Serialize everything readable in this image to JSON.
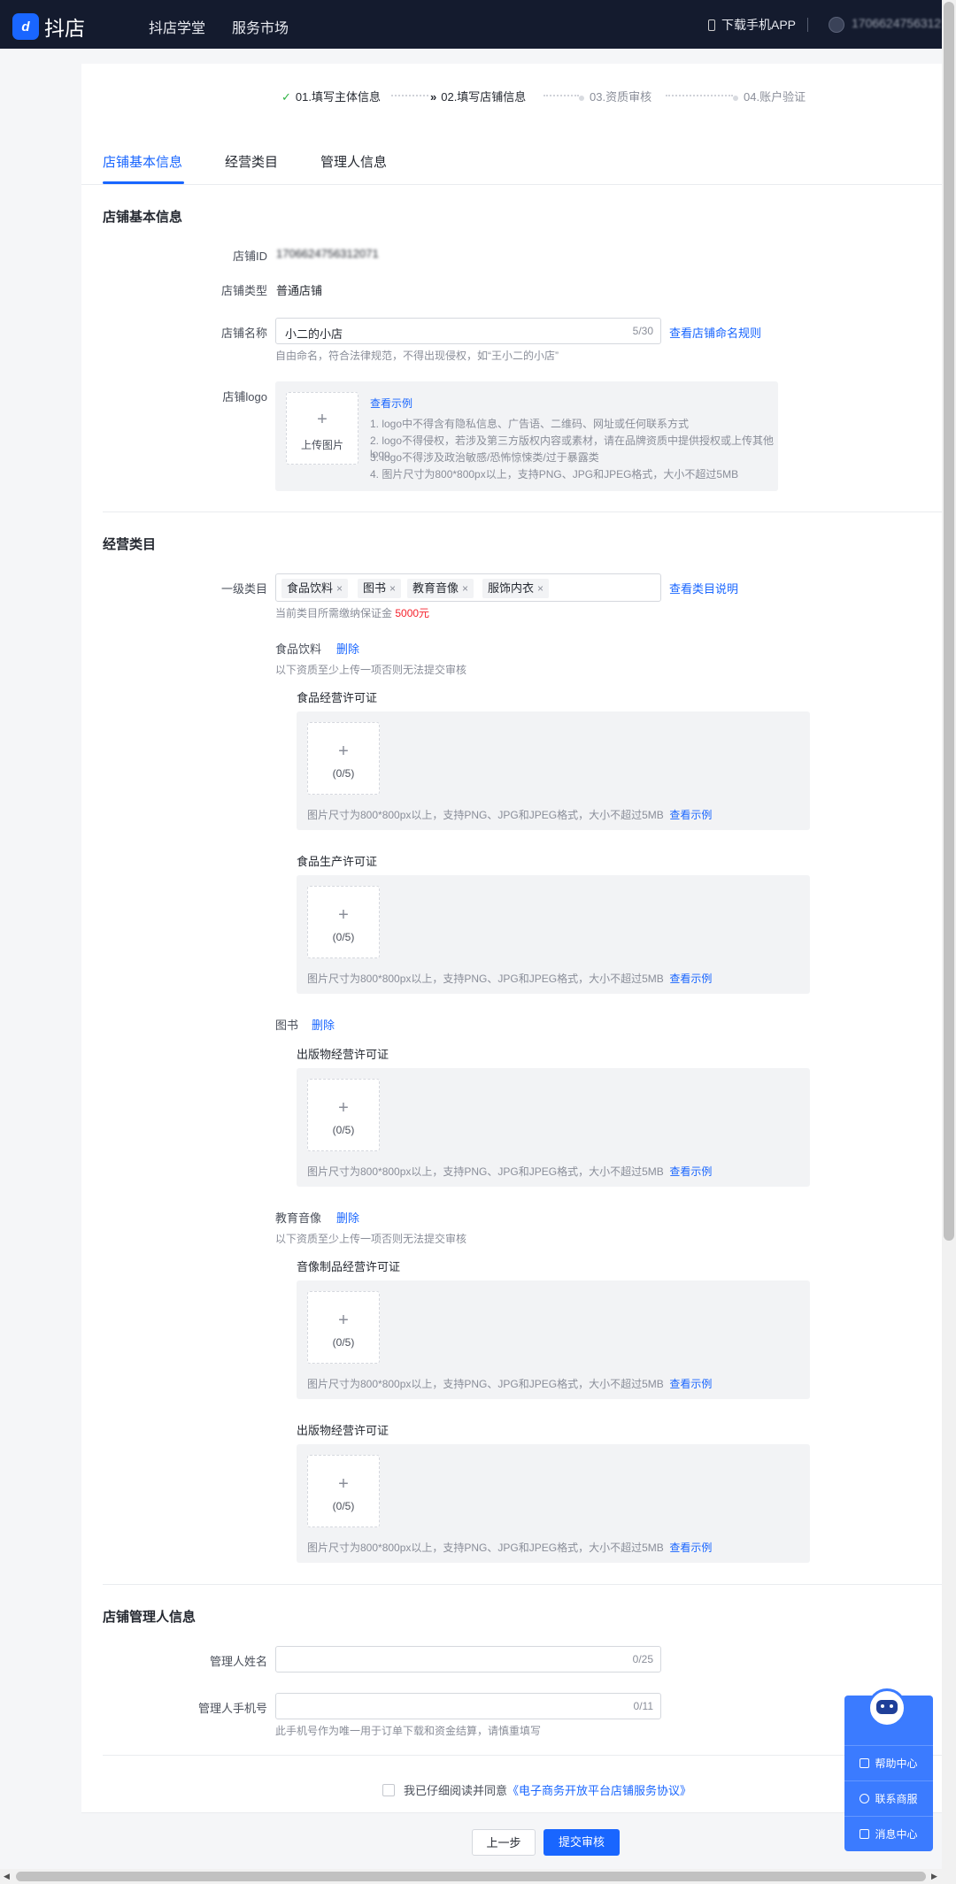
{
  "header": {
    "logo_text": "抖店",
    "nav": [
      "抖店学堂",
      "服务市场"
    ],
    "download_app": "下载手机APP",
    "user_id": "1706624756312"
  },
  "steps": [
    {
      "label": "01.填写主体信息",
      "state": "done"
    },
    {
      "label": "02.填写店铺信息",
      "state": "active"
    },
    {
      "label": "03.资质审核",
      "state": "todo"
    },
    {
      "label": "04.账户验证",
      "state": "todo"
    }
  ],
  "tabs": [
    "店铺基本信息",
    "经营类目",
    "管理人信息"
  ],
  "basic": {
    "title": "店铺基本信息",
    "shop_id_label": "店铺ID",
    "shop_id_value": "1706624756312071",
    "shop_type_label": "店铺类型",
    "shop_type_value": "普通店铺",
    "shop_name_label": "店铺名称",
    "shop_name_value": "小二的小店",
    "shop_name_counter": "5/30",
    "shop_name_rule_link": "查看店铺命名规则",
    "shop_name_hint": "自由命名，符合法律规范，不得出现侵权，如“王小二的小店”",
    "logo_label": "店铺logo",
    "upload_label": "上传图片",
    "example_link": "查看示例",
    "logo_rules": [
      "1. logo中不得含有隐私信息、广告语、二维码、网址或任何联系方式",
      "2. logo不得侵权，若涉及第三方版权内容或素材，请在品牌资质中提供授权或上传其他logo",
      "3. logo不得涉及政治敏感/恐怖惊悚类/过于暴露类",
      "4. 图片尺寸为800*800px以上，支持PNG、JPG和JPEG格式，大小不超过5MB"
    ]
  },
  "category": {
    "title": "经营类目",
    "level1_label": "一级类目",
    "tags": [
      "食品饮料",
      "图书",
      "教育音像",
      "服饰内衣"
    ],
    "tag_close": "×",
    "explain_link": "查看类目说明",
    "deposit_prefix": "当前类目所需缴纳保证金",
    "deposit_amount": "5000元",
    "delete_label": "删除",
    "at_least_one": "以下资质至少上传一项否则无法提交审核",
    "upload_count": "(0/5)",
    "plus": "+",
    "spec_text": "图片尺寸为800*800px以上，支持PNG、JPG和JPEG格式，大小不超过5MB",
    "spec_link": "查看示例",
    "groups": [
      {
        "name": "食品饮料",
        "licenses": [
          "食品经营许可证",
          "食品生产许可证"
        ]
      },
      {
        "name": "图书",
        "licenses": [
          "出版物经营许可证"
        ]
      },
      {
        "name": "教育音像",
        "licenses": [
          "音像制品经营许可证",
          "出版物经营许可证"
        ]
      }
    ]
  },
  "manager": {
    "title": "店铺管理人信息",
    "name_label": "管理人姓名",
    "name_counter": "0/25",
    "phone_label": "管理人手机号",
    "phone_counter": "0/11",
    "phone_hint": "此手机号作为唯一用于订单下载和资金结算，请慎重填写"
  },
  "agreement": {
    "text": "我已仔细阅读并同意",
    "link": "《电子商务开放平台店铺服务协议》"
  },
  "buttons": {
    "prev": "上一步",
    "submit": "提交审核"
  },
  "float_panel": {
    "items": [
      "帮助中心",
      "联系商服",
      "消息中心"
    ]
  },
  "colors": {
    "primary": "#1966ff",
    "header_bg": "#141b2e",
    "danger": "#f5222d",
    "success": "#2fb344"
  }
}
